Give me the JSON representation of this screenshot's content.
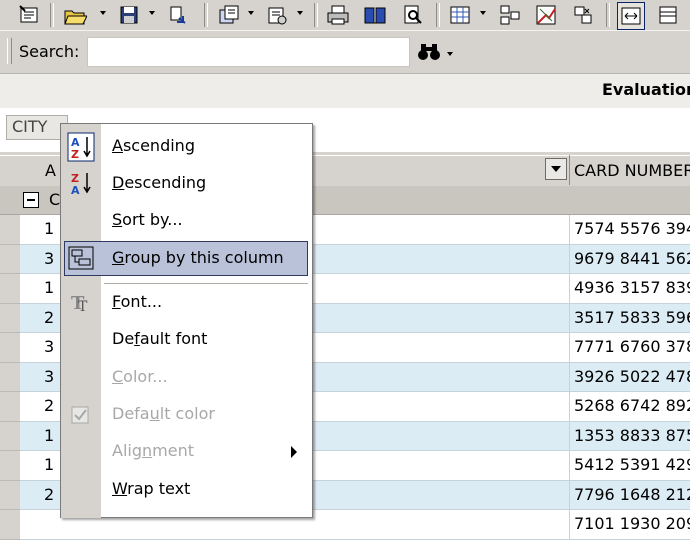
{
  "toolbar": {
    "icons": [
      "properties-icon",
      "open-folder-icon",
      "save-icon",
      "export-icon",
      "new-document-icon",
      "settings-icon",
      "print-icon",
      "book-icon",
      "print-preview-icon",
      "table-view-icon",
      "layout-icon",
      "chart-icon",
      "filter-icon",
      "fit-width-icon",
      "column-icon"
    ]
  },
  "search": {
    "label": "Search:",
    "value": "",
    "find_icon": "binoculars-icon"
  },
  "report": {
    "title": "Evaluation"
  },
  "group_area": {
    "tag_label": "CITY"
  },
  "columns": {
    "a_label": "A",
    "card_label": "CARD NUMBER"
  },
  "group_row": {
    "label": "C"
  },
  "rows": [
    {
      "a": "1",
      "card": "7574 5576 394"
    },
    {
      "a": "3",
      "card": "9679 8441 562"
    },
    {
      "a": "1",
      "card": "4936 3157 839"
    },
    {
      "a": "2",
      "card": "3517 5833 596"
    },
    {
      "a": "3",
      "card": "7771 6760 378"
    },
    {
      "a": "3",
      "card": "3926 5022 478"
    },
    {
      "a": "2",
      "card": "5268 6742 892"
    },
    {
      "a": "1",
      "card": "1353 8833 875"
    },
    {
      "a": "1",
      "card": "5412 5391 429"
    },
    {
      "a": "2",
      "card": "7796 1648 212"
    },
    {
      "a": "",
      "card": "7101 1930 209"
    }
  ],
  "context_menu": {
    "items": [
      {
        "id": "ascending",
        "pre": "",
        "ul": "A",
        "post": "scending",
        "icon": "sort-ascending-icon",
        "enabled": true
      },
      {
        "id": "descending",
        "pre": "",
        "ul": "D",
        "post": "escending",
        "icon": "sort-descending-icon",
        "enabled": true
      },
      {
        "id": "sort-by",
        "pre": "",
        "ul": "S",
        "post": "ort by...",
        "icon": "",
        "enabled": true
      },
      {
        "id": "group-by",
        "pre": "",
        "ul": "G",
        "post": "roup by this column",
        "icon": "group-by-icon",
        "enabled": true
      },
      {
        "id": "font",
        "pre": "",
        "ul": "F",
        "post": "ont...",
        "icon": "font-icon",
        "enabled": true
      },
      {
        "id": "default-font",
        "pre": "De",
        "ul": "f",
        "post": "ault font",
        "icon": "",
        "enabled": true
      },
      {
        "id": "color",
        "pre": "",
        "ul": "C",
        "post": "olor...",
        "icon": "",
        "enabled": false
      },
      {
        "id": "default-color",
        "pre": "Defa",
        "ul": "u",
        "post": "lt color",
        "icon": "check-icon",
        "enabled": false
      },
      {
        "id": "alignment",
        "pre": "Alig",
        "ul": "n",
        "post": "ment",
        "icon": "",
        "enabled": false
      },
      {
        "id": "wrap-text",
        "pre": "",
        "ul": "W",
        "post": "rap text",
        "icon": "",
        "enabled": true
      }
    ],
    "highlighted": "group-by"
  },
  "colors": {
    "row_alt": "#dcecf5",
    "highlight": "#b9c2d9",
    "chrome": "#d6d3ce"
  }
}
